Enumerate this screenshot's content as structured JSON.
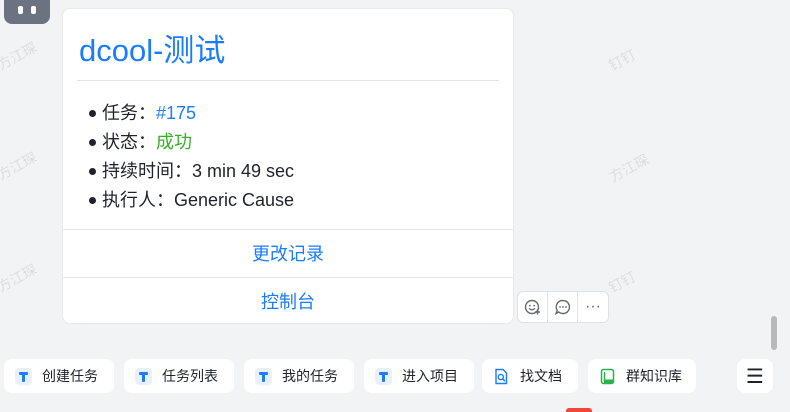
{
  "watermark": "方江琛",
  "watermark_alt": "钉钉",
  "card": {
    "title": "dcool-测试",
    "items": [
      {
        "label": "任务：",
        "value": "#175",
        "style": "link"
      },
      {
        "label": "状态：",
        "value": "成功",
        "style": "success"
      },
      {
        "label": "持续时间：",
        "value": "3 min 49 sec",
        "style": "plain"
      },
      {
        "label": "执行人：",
        "value": "Generic Cause",
        "style": "plain"
      }
    ],
    "actions": [
      "更改记录",
      "控制台"
    ]
  },
  "reactions": {
    "emoji_icon": "emoji-add-icon",
    "reply_icon": "reply-icon",
    "more_icon": "more-icon",
    "more_label": "···"
  },
  "toolbar": {
    "chips": [
      {
        "label": "创建任务",
        "icon": "teambition-icon"
      },
      {
        "label": "任务列表",
        "icon": "teambition-icon"
      },
      {
        "label": "我的任务",
        "icon": "teambition-icon"
      },
      {
        "label": "进入项目",
        "icon": "teambition-icon"
      },
      {
        "label": "找文档",
        "icon": "doc-search-icon"
      },
      {
        "label": "群知识库",
        "icon": "book-icon"
      }
    ],
    "menu_label": "☰"
  },
  "colors": {
    "accent": "#1a7dff",
    "success": "#34b224",
    "background": "#f2f3f5"
  }
}
